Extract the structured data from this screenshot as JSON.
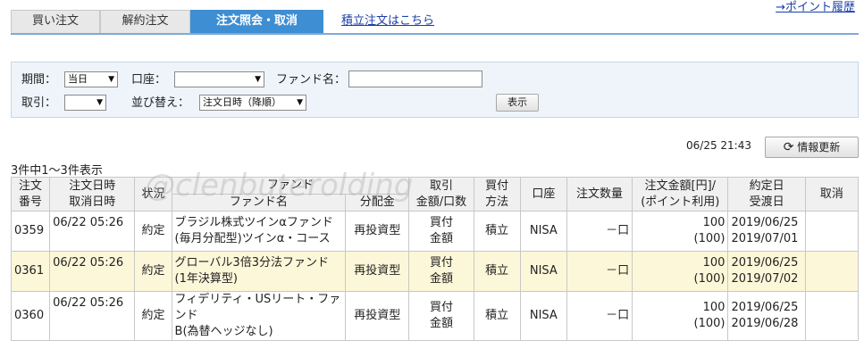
{
  "header": {
    "point_history_link": "→ポイント履歴"
  },
  "tabs": [
    {
      "label": "買い注文"
    },
    {
      "label": "解約注文"
    },
    {
      "label": "注文照会・取消"
    }
  ],
  "tab_link": "積立注文はこちら",
  "filters": {
    "period_label": "期間：",
    "period_value": "当日",
    "account_label": "口座：",
    "account_value": "",
    "fund_name_label": "ファンド名：",
    "fund_name_value": "",
    "trade_label": "取引：",
    "trade_value": "",
    "sort_label": "並び替え：",
    "sort_value": "注文日時（降順）",
    "display_button": "表示"
  },
  "status": {
    "timestamp": "06/25 21:43",
    "refresh_button": "情報更新",
    "count_text": "3件中1～3件表示"
  },
  "watermark": "@clenbuterolding",
  "table": {
    "headers": {
      "order_no_1": "注文",
      "order_no_2": "番号",
      "order_date_1": "注文日時",
      "order_date_2": "取消日時",
      "status": "状況",
      "fund_group": "ファンド",
      "fund_name": "ファンド名",
      "distribution": "分配金",
      "trade_1": "取引",
      "trade_2": "金額/口数",
      "pay_1": "買付",
      "pay_2": "方法",
      "account": "口座",
      "quantity": "注文数量",
      "amount_1": "注文金額[円]/",
      "amount_2": "(ポイント利用)",
      "date_1": "約定日",
      "date_2": "受渡日",
      "cancel": "取消"
    },
    "rows": [
      {
        "order_no": "0359",
        "order_date": "06/22 05:26",
        "status": "約定",
        "fund_1": "ブラジル株式ツインαファンド",
        "fund_2": "(毎月分配型)ツインα・コース",
        "distribution": "再投資型",
        "trade_1": "買付",
        "trade_2": "金額",
        "pay": "積立",
        "account": "NISA",
        "quantity": "－口",
        "amount": "100",
        "points": "(100)",
        "exec_date": "2019/06/25",
        "settle_date": "2019/07/01"
      },
      {
        "order_no": "0361",
        "order_date": "06/22 05:26",
        "status": "約定",
        "fund_1": "グローバル3倍3分法ファンド",
        "fund_2": "(1年決算型)",
        "distribution": "再投資型",
        "trade_1": "買付",
        "trade_2": "金額",
        "pay": "積立",
        "account": "NISA",
        "quantity": "－口",
        "amount": "100",
        "points": "(100)",
        "exec_date": "2019/06/25",
        "settle_date": "2019/07/02"
      },
      {
        "order_no": "0360",
        "order_date": "06/22 05:26",
        "status": "約定",
        "fund_1": "フィデリティ・USリート・ファンド",
        "fund_2": "B(為替ヘッジなし)",
        "distribution": "再投資型",
        "trade_1": "買付",
        "trade_2": "金額",
        "pay": "積立",
        "account": "NISA",
        "quantity": "－口",
        "amount": "100",
        "points": "(100)",
        "exec_date": "2019/06/25",
        "settle_date": "2019/06/28"
      }
    ]
  }
}
